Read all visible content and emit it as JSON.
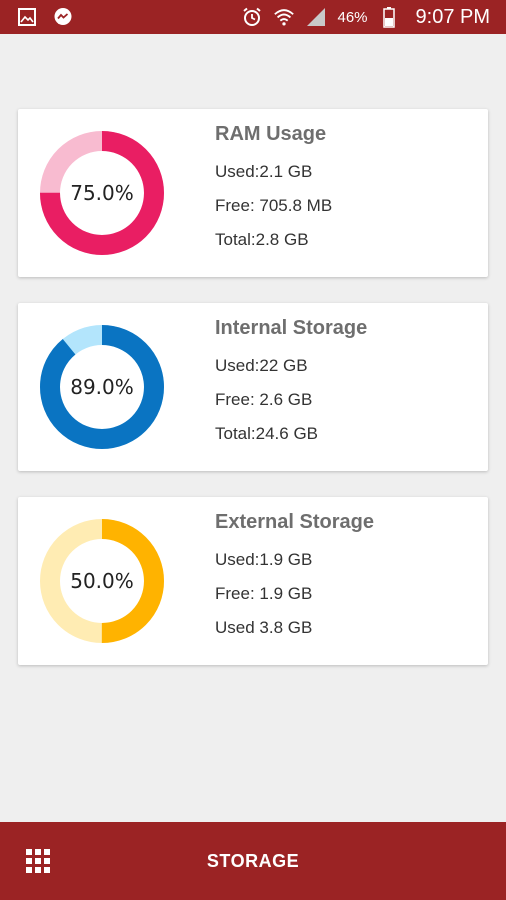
{
  "status_bar": {
    "battery": "46%",
    "time": "9:07 PM",
    "icons": [
      "gallery-icon",
      "messenger-icon",
      "alarm-icon",
      "wifi-icon",
      "signal-icon",
      "battery-icon"
    ]
  },
  "cards": [
    {
      "title": "RAM Usage",
      "percent_label": "75.0%",
      "percent": 75.0,
      "used": "Used:2.1 GB",
      "free": "Free: 705.8 MB",
      "total": "Total:2.8 GB",
      "color_used": "#e91e63",
      "color_free": "#f8bbd0"
    },
    {
      "title": "Internal Storage",
      "percent_label": "89.0%",
      "percent": 89.0,
      "used": "Used:22 GB",
      "free": "Free: 2.6 GB",
      "total": "Total:24.6 GB",
      "color_used": "#0a74c2",
      "color_free": "#b3e5fc"
    },
    {
      "title": "External Storage",
      "percent_label": "50.0%",
      "percent": 50.0,
      "used": "Used:1.9 GB",
      "free": "Free: 1.9 GB",
      "total": "Used 3.8 GB",
      "color_used": "#ffb300",
      "color_free": "#ffecb3"
    }
  ],
  "bottom_bar": {
    "label": "STORAGE",
    "menu_icon": "grid-icon"
  },
  "colors": {
    "brand": "#9b2324",
    "background": "#efefef"
  }
}
